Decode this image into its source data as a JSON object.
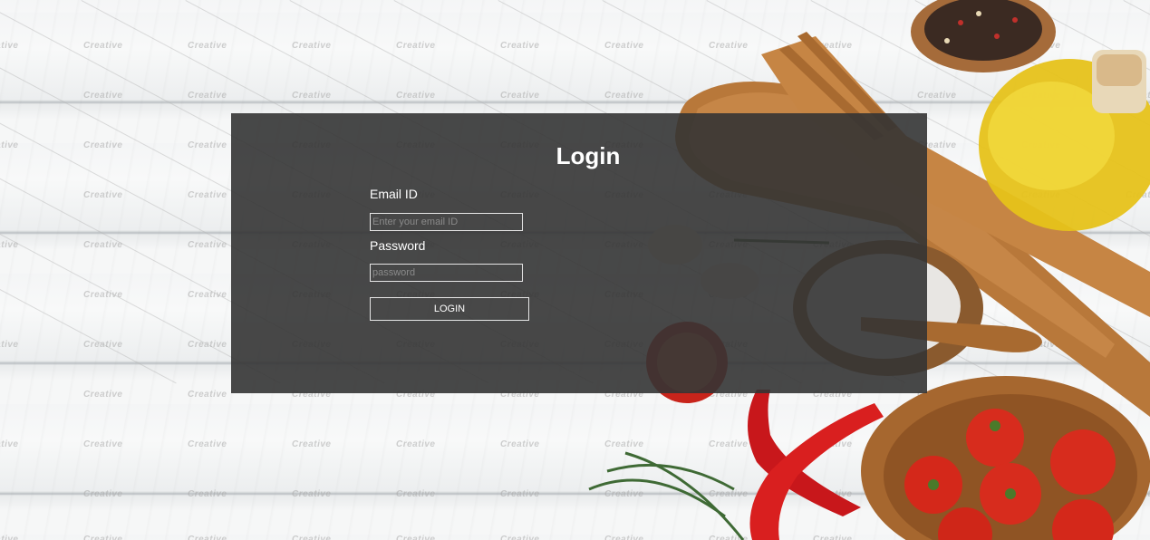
{
  "login": {
    "title": "Login",
    "email_label": "Email ID",
    "email_placeholder": "Enter your email ID",
    "password_label": "Password",
    "password_placeholder": "password",
    "button_label": "LOGIN"
  },
  "watermark": {
    "text": "Creative"
  },
  "colors": {
    "panel_bg": "#343434",
    "panel_text": "#ffffff",
    "background": "#f4f5f6"
  }
}
